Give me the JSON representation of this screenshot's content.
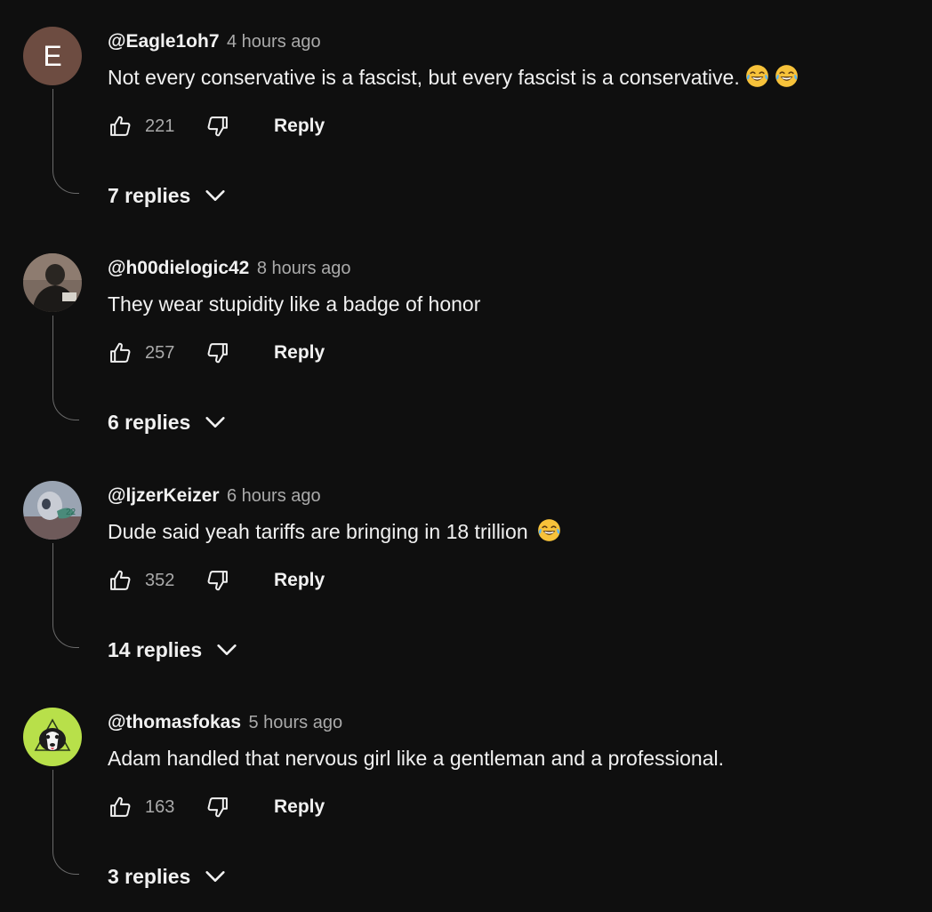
{
  "comments": [
    {
      "author": "@Eagle1oh7",
      "time": "4 hours ago",
      "text": "Not every conservative is a fascist, but every fascist is a conservative.",
      "emojis": [
        "face-with-tears-of-joy",
        "face-with-tears-of-joy"
      ],
      "avatar_letter": "E",
      "likes": "221",
      "reply_label": "Reply",
      "replies_label": "7 replies"
    },
    {
      "author": "@h00dielogic42",
      "time": "8 hours ago",
      "text": "They wear stupidity like a badge of honor",
      "emojis": [],
      "likes": "257",
      "reply_label": "Reply",
      "replies_label": "6 replies"
    },
    {
      "author": "@ljzerKeizer",
      "time": "6 hours ago",
      "text": "Dude said yeah tariffs are bringing in 18 trillion",
      "emojis": [
        "face-with-tears-of-joy"
      ],
      "likes": "352",
      "reply_label": "Reply",
      "replies_label": "14 replies"
    },
    {
      "author": "@thomasfokas",
      "time": "5 hours ago",
      "text": "Adam handled that nervous girl like a gentleman and a professional.",
      "emojis": [],
      "likes": "163",
      "reply_label": "Reply",
      "replies_label": "3 replies"
    }
  ],
  "icons": {
    "like": "thumbs-up-icon",
    "dislike": "thumbs-down-icon",
    "expand": "chevron-down-icon"
  },
  "colors": {
    "background": "#0f0f0f",
    "primary_text": "#f1f1f1",
    "secondary_text": "#aaaaaa",
    "thread_line": "#6a6a6a",
    "avatar_letter_bg": "#6d4c41"
  }
}
